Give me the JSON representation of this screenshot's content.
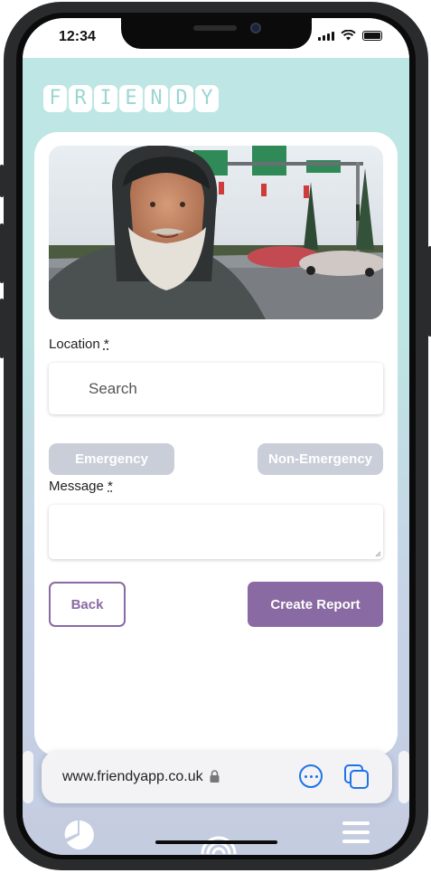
{
  "status_bar": {
    "time": "12:34"
  },
  "app": {
    "logo_letters": [
      "F",
      "R",
      "I",
      "E",
      "N",
      "D",
      "Y"
    ]
  },
  "form": {
    "location_label": "Location",
    "required_marker": "*",
    "search_placeholder": "Search",
    "emergency_label": "Emergency",
    "non_emergency_label": "Non-Emergency",
    "message_label": "Message",
    "back_label": "Back",
    "create_label": "Create Report"
  },
  "browser": {
    "url": "www.friendyapp.co.uk"
  },
  "colors": {
    "accent": "#8a6aa2",
    "teal_bg": "#bde6e4",
    "pill_gray": "#c9ced8",
    "safari_blue": "#1d73e8"
  },
  "icons": {
    "hero": "bearded-man-photo",
    "lock": "lock-icon",
    "more": "more-icon",
    "tabs": "tabs-icon",
    "nav": [
      "pie-chart-icon",
      "radar-icon",
      "menu-icon"
    ]
  }
}
